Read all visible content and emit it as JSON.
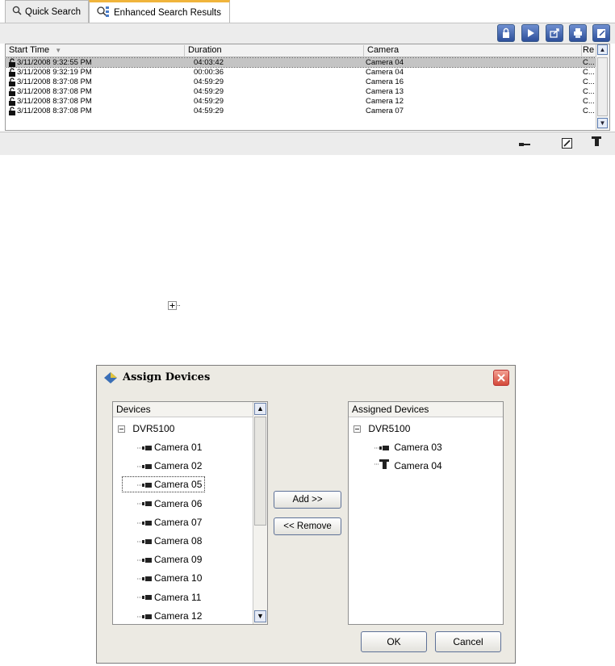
{
  "search_panel": {
    "tabs": [
      {
        "label": "Quick Search",
        "icon": "magnifier-icon"
      },
      {
        "label": "Enhanced Search Results",
        "icon": "enhanced-search-icon"
      }
    ],
    "toolbar": {
      "icons": [
        "lock-icon",
        "play-icon",
        "export-icon",
        "print-icon",
        "edit-icon"
      ]
    },
    "grid": {
      "columns": [
        "Start Time",
        "Duration",
        "Camera",
        "Re"
      ],
      "rows": [
        {
          "start": "3/11/2008 9:32:55 PM",
          "duration": "04:03:42",
          "camera": "Camera 04",
          "re": "C..."
        },
        {
          "start": "3/11/2008 9:32:19 PM",
          "duration": "00:00:36",
          "camera": "Camera 04",
          "re": "C..."
        },
        {
          "start": "3/11/2008 8:37:08 PM",
          "duration": "04:59:29",
          "camera": "Camera 16",
          "re": "C..."
        },
        {
          "start": "3/11/2008 8:37:08 PM",
          "duration": "04:59:29",
          "camera": "Camera 13",
          "re": "C..."
        },
        {
          "start": "3/11/2008 8:37:08 PM",
          "duration": "04:59:29",
          "camera": "Camera 12",
          "re": "C..."
        },
        {
          "start": "3/11/2008 8:37:08 PM",
          "duration": "04:59:29",
          "camera": "Camera 07",
          "re": "C..."
        }
      ]
    },
    "status_icons": [
      "key-icon",
      "edit-icon",
      "camera-icon"
    ]
  },
  "dialog": {
    "title": "Assign Devices",
    "devices_header": "Devices",
    "assigned_header": "Assigned Devices",
    "root": "DVR5100",
    "devices": [
      "Camera 01",
      "Camera 02",
      "Camera 05",
      "Camera 06",
      "Camera 07",
      "Camera 08",
      "Camera 09",
      "Camera 10",
      "Camera 11",
      "Camera 12"
    ],
    "selected_device": "Camera 05",
    "assigned": [
      {
        "label": "Camera 03",
        "icon": "box-camera-icon"
      },
      {
        "label": "Camera 04",
        "icon": "dome-camera-icon"
      }
    ],
    "add_label": "Add >>",
    "remove_label": "<< Remove",
    "ok_label": "OK",
    "cancel_label": "Cancel"
  }
}
